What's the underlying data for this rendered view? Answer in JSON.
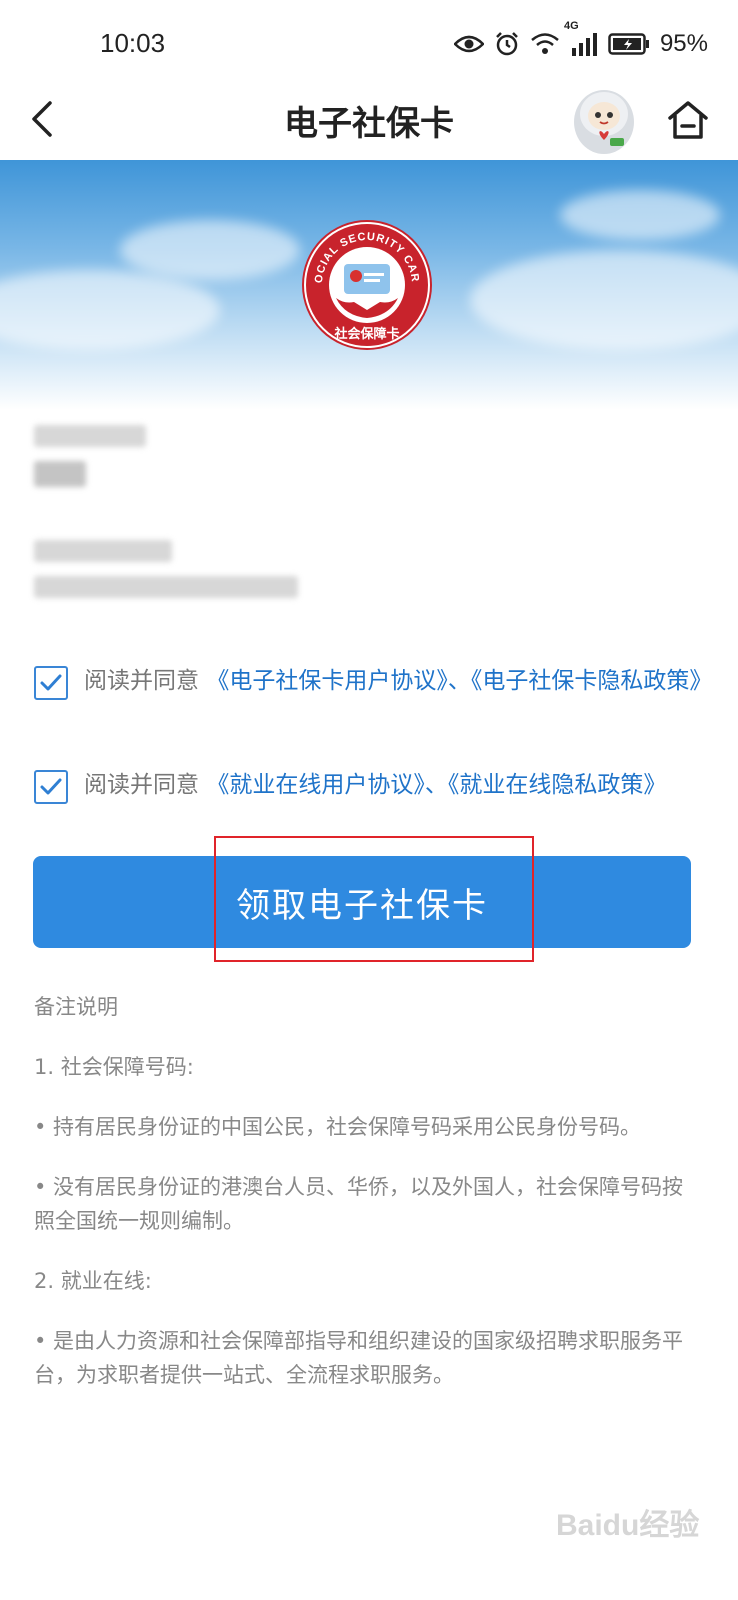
{
  "status_bar": {
    "time": "10:03",
    "network": "4G",
    "battery": "95%"
  },
  "nav": {
    "title": "电子社保卡",
    "back_icon": "chevron-left-icon",
    "home_icon": "home-icon"
  },
  "logo": {
    "arc_text": "SOCIAL SECURITY CARD",
    "bottom_text": "社会保障卡"
  },
  "agreements": [
    {
      "checked": true,
      "prefix": "阅读并同意 ",
      "link1": "《电子社保卡用户协议》",
      "sep": "、",
      "link2": "《电子社保卡隐私政策》"
    },
    {
      "checked": true,
      "prefix": "阅读并同意 ",
      "link1": "《就业在线用户协议》",
      "sep": "、",
      "link2": "《就业在线隐私政策》"
    }
  ],
  "claim_button": {
    "label": "领取电子社保卡"
  },
  "notes": {
    "title": "备注说明",
    "section1_title": "1. 社会保障号码:",
    "section1_item1": "• 持有居民身份证的中国公民，社会保障号码采用公民身份号码。",
    "section1_item2": "• 没有居民身份证的港澳台人员、华侨，以及外国人，社会保障号码按照全国统一规则编制。",
    "section2_title": "2. 就业在线:",
    "section2_item1": "• 是由人力资源和社会保障部指导和组织建设的国家级招聘求职服务平台，为求职者提供一站式、全流程求职服务。"
  },
  "watermark": "Baidu经验",
  "colors": {
    "accent": "#2f8ae0",
    "link": "#1f73c9",
    "highlight": "#e0242a"
  }
}
